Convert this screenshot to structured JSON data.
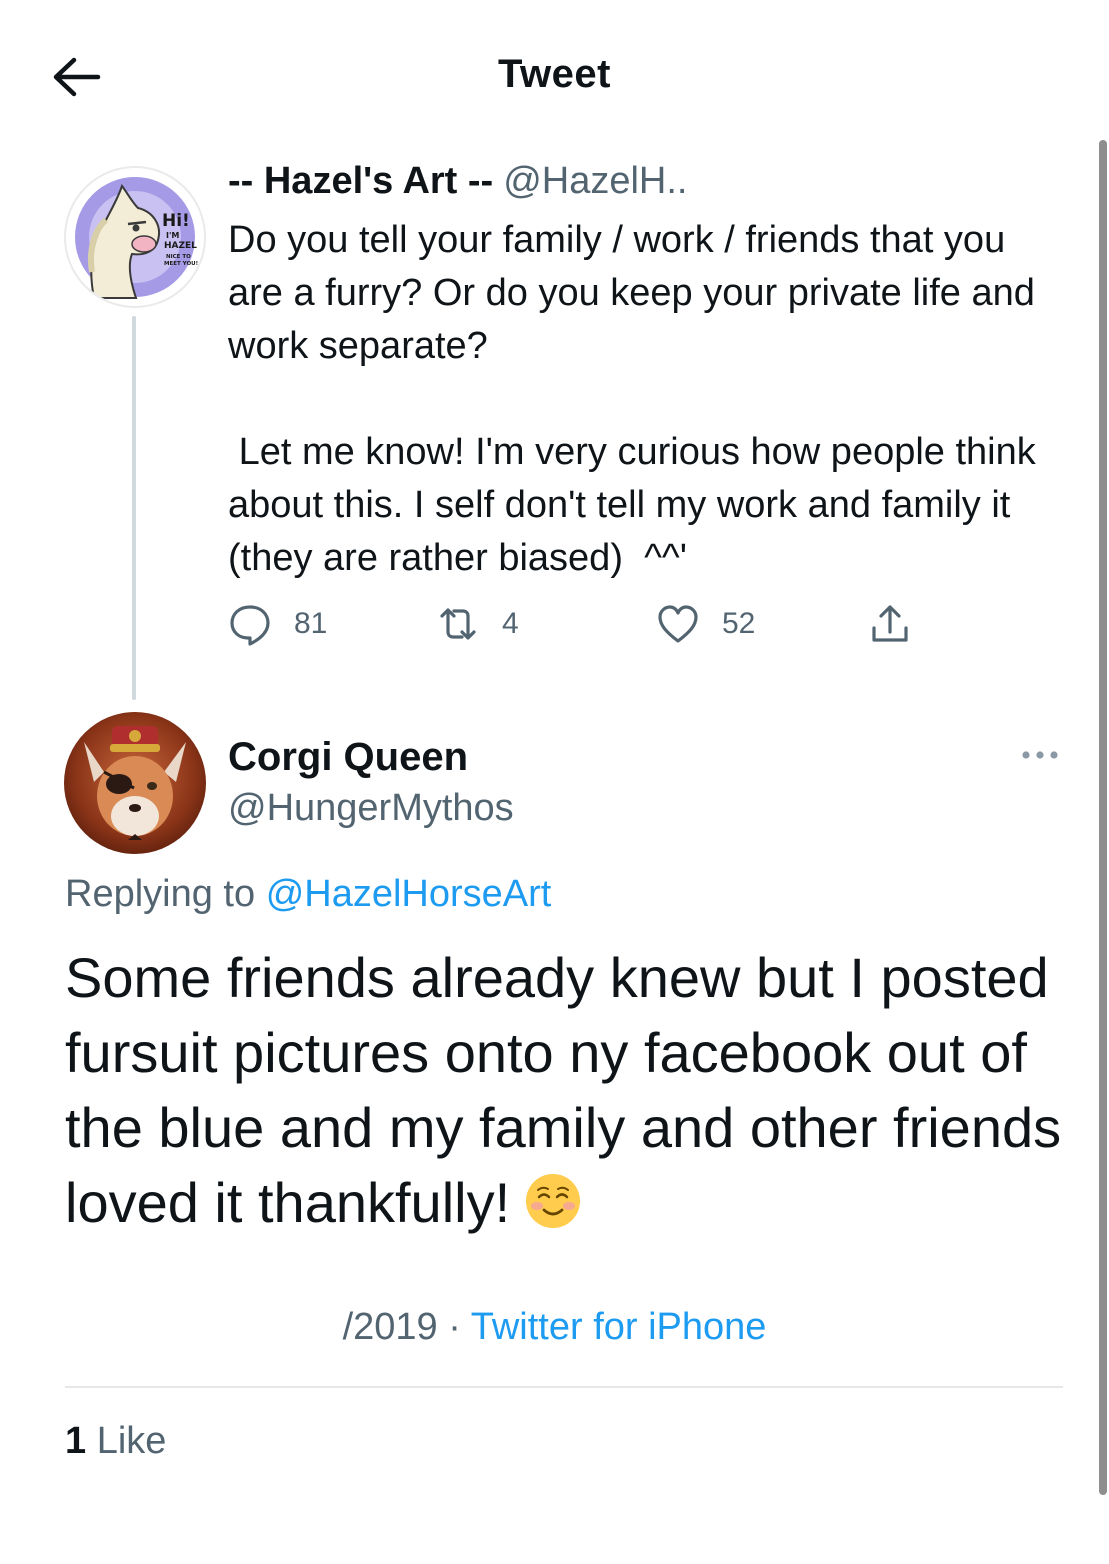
{
  "header": {
    "title": "Tweet",
    "back_icon": "arrow-left-icon"
  },
  "original_tweet": {
    "display_name": "-- Hazel's Art --",
    "handle": "@HazelH..",
    "avatar_text": {
      "line1": "Hi!",
      "line2": "I'M",
      "line3": "HAZEL",
      "line4": "NICE TO",
      "line5": "MEET YOU!"
    },
    "text": "Do you tell your family / work / friends that you are a furry? Or do you keep your private life and work separate?\n\n Let me know! I'm very curious how people think about this. I self don't tell my work and family it (they are rather biased)  ^^'",
    "reply_count": "81",
    "retweet_count": "4",
    "like_count": "52",
    "icons": {
      "reply": "reply-bubble-icon",
      "retweet": "retweet-icon",
      "like": "heart-icon",
      "share": "share-icon"
    }
  },
  "reply_tweet": {
    "display_name": "Corgi Queen",
    "handle": "@HungerMythos",
    "replying_prefix": "Replying to",
    "replying_to": "@HazelHorseArt",
    "text": "Some friends already knew but I posted fursuit pictures onto ny facebook out of the blue and my family and other friends loved it thankfully!",
    "emoji": "smiling-face-icon",
    "date": "/2019",
    "separator": "·",
    "source": "Twitter for iPhone",
    "like_count": "1",
    "like_label": "Like",
    "more_icon": "more-dots-icon"
  },
  "colors": {
    "text": "#0f1419",
    "secondary": "#536471",
    "link": "#1d9bf0",
    "thread_line": "#cfd9de",
    "divider": "#e7e7e7"
  }
}
